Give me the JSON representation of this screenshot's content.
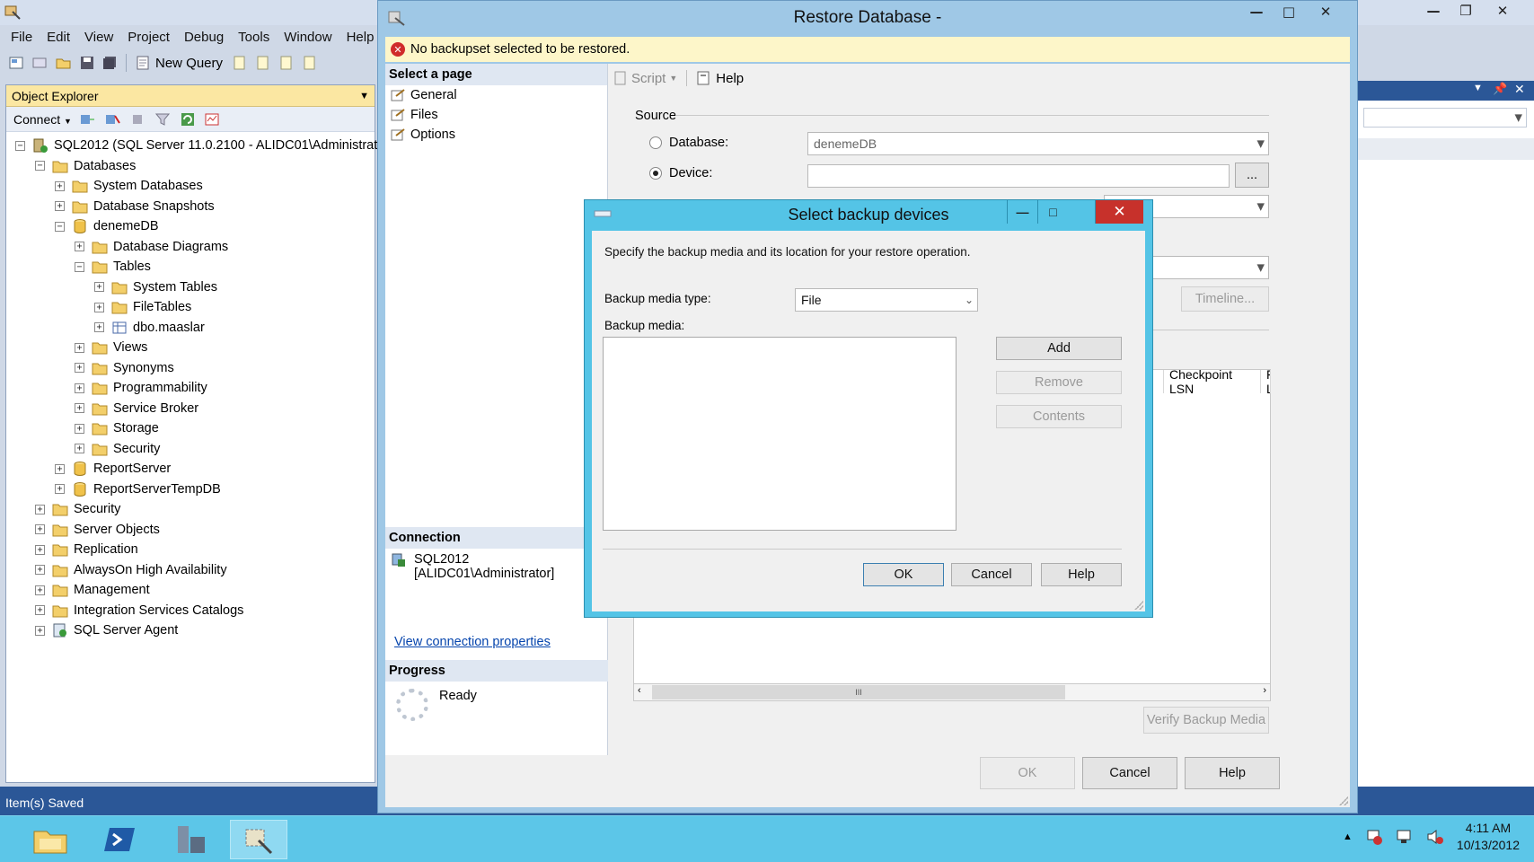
{
  "ssms": {
    "menu": [
      "File",
      "Edit",
      "View",
      "Project",
      "Debug",
      "Tools",
      "Window",
      "Help"
    ],
    "toolbar": {
      "new_query": "New Query"
    },
    "object_explorer": {
      "title": "Object Explorer",
      "connect": "Connect",
      "tree": [
        {
          "label": "SQL2012 (SQL Server 11.0.2100 - ALIDC01\\Administrat",
          "depth": 0,
          "expander": "−",
          "icon": "server-icon"
        },
        {
          "label": "Databases",
          "depth": 1,
          "expander": "−",
          "icon": "folder-icon"
        },
        {
          "label": "System Databases",
          "depth": 2,
          "expander": "+",
          "icon": "folder-icon"
        },
        {
          "label": "Database Snapshots",
          "depth": 2,
          "expander": "+",
          "icon": "folder-icon"
        },
        {
          "label": "denemeDB",
          "depth": 2,
          "expander": "−",
          "icon": "database-icon"
        },
        {
          "label": "Database Diagrams",
          "depth": 3,
          "expander": "+",
          "icon": "folder-icon"
        },
        {
          "label": "Tables",
          "depth": 3,
          "expander": "−",
          "icon": "folder-icon"
        },
        {
          "label": "System Tables",
          "depth": 4,
          "expander": "+",
          "icon": "folder-icon"
        },
        {
          "label": "FileTables",
          "depth": 4,
          "expander": "+",
          "icon": "folder-icon"
        },
        {
          "label": "dbo.maaslar",
          "depth": 4,
          "expander": "+",
          "icon": "table-icon"
        },
        {
          "label": "Views",
          "depth": 3,
          "expander": "+",
          "icon": "folder-icon"
        },
        {
          "label": "Synonyms",
          "depth": 3,
          "expander": "+",
          "icon": "folder-icon"
        },
        {
          "label": "Programmability",
          "depth": 3,
          "expander": "+",
          "icon": "folder-icon"
        },
        {
          "label": "Service Broker",
          "depth": 3,
          "expander": "+",
          "icon": "folder-icon"
        },
        {
          "label": "Storage",
          "depth": 3,
          "expander": "+",
          "icon": "folder-icon"
        },
        {
          "label": "Security",
          "depth": 3,
          "expander": "+",
          "icon": "folder-icon"
        },
        {
          "label": "ReportServer",
          "depth": 2,
          "expander": "+",
          "icon": "database-icon"
        },
        {
          "label": "ReportServerTempDB",
          "depth": 2,
          "expander": "+",
          "icon": "database-icon"
        },
        {
          "label": "Security",
          "depth": 1,
          "expander": "+",
          "icon": "folder-icon"
        },
        {
          "label": "Server Objects",
          "depth": 1,
          "expander": "+",
          "icon": "folder-icon"
        },
        {
          "label": "Replication",
          "depth": 1,
          "expander": "+",
          "icon": "folder-icon"
        },
        {
          "label": "AlwaysOn High Availability",
          "depth": 1,
          "expander": "+",
          "icon": "folder-icon"
        },
        {
          "label": "Management",
          "depth": 1,
          "expander": "+",
          "icon": "folder-icon"
        },
        {
          "label": "Integration Services Catalogs",
          "depth": 1,
          "expander": "+",
          "icon": "folder-icon"
        },
        {
          "label": "SQL Server Agent",
          "depth": 1,
          "expander": "+",
          "icon": "agent-icon"
        }
      ]
    },
    "status": "Item(s) Saved"
  },
  "restore": {
    "title": "Restore Database -",
    "warning": "No backupset selected to be restored.",
    "select_page": "Select a page",
    "pages": [
      "General",
      "Files",
      "Options"
    ],
    "toolbar": {
      "script": "Script",
      "help": "Help"
    },
    "source_label": "Source",
    "database_label": "Database:",
    "database_value": "denemeDB",
    "device_label": "Device:",
    "browse_label": "...",
    "timeline_label": "Timeline...",
    "grid_columns": [
      "LSN",
      "Checkpoint LSN",
      "Full L"
    ],
    "grid_scroll_thumb": "III",
    "connection_head": "Connection",
    "connection_server": "SQL2012",
    "connection_user": "[ALIDC01\\Administrator]",
    "view_connection": "View connection properties",
    "progress_head": "Progress",
    "progress_status": "Ready",
    "verify_label": "Verify Backup Media",
    "ok_label": "OK",
    "cancel_label": "Cancel",
    "help_label": "Help"
  },
  "dialog": {
    "title": "Select backup devices",
    "description": "Specify the backup media and its location for your restore operation.",
    "media_type_label": "Backup media type:",
    "media_type_value": "File",
    "media_label": "Backup media:",
    "add_label": "Add",
    "remove_label": "Remove",
    "contents_label": "Contents",
    "ok_label": "OK",
    "cancel_label": "Cancel",
    "help_label": "Help"
  },
  "taskbar": {
    "time": "4:11 AM",
    "date": "10/13/2012"
  },
  "colors": {
    "taskbar": "#5cc6e8",
    "dialog_frame": "#54c4e6",
    "close_button": "#c7312b",
    "warning_bg": "#fdf6c9",
    "oe_header": "#fbe7a2"
  }
}
